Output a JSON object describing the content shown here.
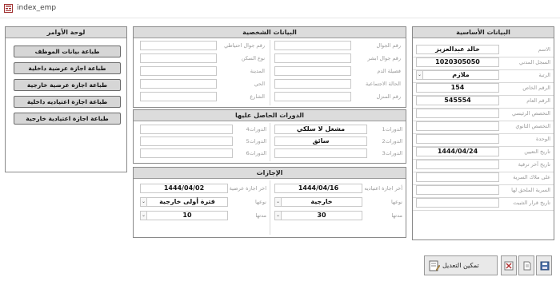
{
  "window": {
    "title": "index_emp"
  },
  "commands": {
    "header": "لوحة الأوامر",
    "buttons": [
      "طباعة بيانات الموظف",
      "طباعة اجازة عرضية داخلية",
      "طباعة اجازة عرضية خارجية",
      "طباعة اجازة اعتياديه داخلية",
      "طباعة اجازة اعتيادية خارجية"
    ]
  },
  "basic": {
    "header": "البيانات الأساسية",
    "fields": [
      {
        "label": "الاسم",
        "value": "خالد عبدالعزيز"
      },
      {
        "label": "السجل المدني",
        "value": "1020305050"
      },
      {
        "label": "الرتبة",
        "value": "ملازم"
      },
      {
        "label": "الرقم الخاص",
        "value": "154"
      },
      {
        "label": "الرقم العام",
        "value": "545554"
      },
      {
        "label": "التخصص الرئيسي",
        "value": ""
      },
      {
        "label": "التخصص الثانوي",
        "value": ""
      },
      {
        "label": "الوحدة",
        "value": ""
      },
      {
        "label": "تاريخ التعيين",
        "value": "1444/04/24"
      },
      {
        "label": "تاريخ آخر ترقية",
        "value": ""
      },
      {
        "label": "على ملاك السرية",
        "value": ""
      },
      {
        "label": "السرية الملحق لها",
        "value": ""
      },
      {
        "label": "تاريخ قرار التثبيت",
        "value": ""
      }
    ]
  },
  "personal": {
    "header": "البيانات الشخصية",
    "right": [
      "رقم الجوال",
      "رقم جوال ابشر",
      "فصيلة الدم",
      "الحالة الاجتماعية",
      "رقم المنزل"
    ],
    "left": [
      "رقم جوال احتياطي",
      "نوع السكن",
      "المدينة",
      "الحي",
      "الشارع"
    ]
  },
  "courses": {
    "header": "الدورات الحاصل عليها",
    "rows": [
      {
        "label_r": "الدورات1",
        "value_r": "مشغل لا سلكي",
        "label_l": "الدورات4",
        "value_l": ""
      },
      {
        "label_r": "الدورات2",
        "value_r": "سائق",
        "label_l": "الدورات5",
        "value_l": ""
      },
      {
        "label_r": "الدورات3",
        "value_r": "",
        "label_l": "الدورات6",
        "value_l": ""
      }
    ]
  },
  "leaves": {
    "header": "الإجازات",
    "right": [
      {
        "label": "أخر اجازة اعتياديه",
        "value": "1444/04/16"
      },
      {
        "label": "نوعها",
        "value": "خارجية"
      },
      {
        "label": "مدتها",
        "value": "30"
      }
    ],
    "left": [
      {
        "label": "اخر اجازة عرضية",
        "value": "1444/04/02"
      },
      {
        "label": "نوعها",
        "value": "فترة أولى خارجية"
      },
      {
        "label": "مدتها",
        "value": "10"
      }
    ]
  },
  "footer": {
    "edit_button": "تمكين التعديل"
  }
}
